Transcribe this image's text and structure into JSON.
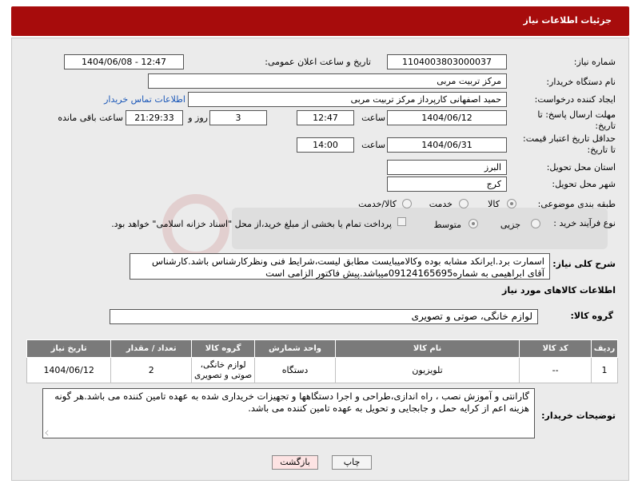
{
  "header": {
    "title": "جزئیات اطلاعات نیاز"
  },
  "form": {
    "need_number_label": "شماره نیاز:",
    "need_number": "1104003803000037",
    "announce_label": "تاریخ و ساعت اعلان عمومی:",
    "announce_value": "1404/06/08 - 12:47",
    "buyer_org_label": "نام دستگاه خریدار:",
    "buyer_org": "مرکز تربیت مربی",
    "requester_label": "ایجاد کننده درخواست:",
    "requester": "حمید اصفهانی کارپرداز مرکز تربیت مربی",
    "contact_link": "اطلاعات تماس خریدار",
    "deadline_label_1": "مهلت ارسال پاسخ: تا",
    "deadline_label_2": "تاریخ:",
    "deadline_date": "1404/06/12",
    "time_label": "ساعت",
    "deadline_time": "12:47",
    "days_value": "3",
    "days_label": "روز و",
    "remaining_value": "21:29:33",
    "remaining_label": "ساعت باقی مانده",
    "validity_label_1": "حداقل تاریخ اعتبار قیمت:",
    "validity_label_2": "تا تاریخ:",
    "validity_date": "1404/06/31",
    "validity_time_label": "ساعت",
    "validity_time": "14:00",
    "province_label": "استان محل تحویل:",
    "province": "البرز",
    "city_label": "شهر محل تحویل:",
    "city": "کرج",
    "category_label": "طبقه بندی موضوعی:",
    "category_options": [
      "کالا",
      "خدمت",
      "کالا/خدمت"
    ],
    "category_selected": "کالا",
    "process_label": "نوع فرآیند خرید :",
    "process_options": [
      "جزیی",
      "متوسط"
    ],
    "process_selected": "متوسط",
    "payment_note": "پرداخت تمام یا بخشی از مبلغ خرید،از محل \"اسناد خزانه اسلامی\" خواهد بود."
  },
  "description": {
    "label": "شرح کلی نیاز:",
    "text": "اسمارت برد.ایرانکد مشابه بوده وکالامیبایست مطابق لیست،شرایط فنی ونظرکارشناس باشد.کارشناس آقای ابراهیمی به شماره09124165695میباشد.پیش فاکتور الزامی است"
  },
  "goods": {
    "section_title": "اطلاعات کالاهای مورد نیاز",
    "group_label": "گروه کالا:",
    "group_value": "لوازم خانگی، صوتی و تصویری"
  },
  "table": {
    "headers": [
      "ردیف",
      "کد کالا",
      "نام کالا",
      "واحد شمارش",
      "گروه کالا",
      "تعداد / مقدار",
      "تاریخ نیاز"
    ],
    "rows": [
      {
        "row": "1",
        "code": "--",
        "name": "تلویزیون",
        "unit": "دستگاه",
        "group": "لوازم خانگی، صوتی و تصویری",
        "qty": "2",
        "date": "1404/06/12"
      }
    ]
  },
  "buyer_notes": {
    "label": "توضیحات خریدار:",
    "text": "گارانتی و آموزش نصب ، راه اندازی،طراحی و اجرا دستگاهها و تجهیزات خریداری شده به عهده تامین کننده می باشد.هر گونه هزینه اعم از کرایه حمل و جابجایی و تحویل به عهده تامین کننده می باشد."
  },
  "buttons": {
    "print": "چاپ",
    "back": "بازگشت"
  },
  "colors": {
    "header": "#a70c0c",
    "panel": "#ebebeb",
    "table_header": "#7a7a7a",
    "link": "#1a57b8"
  }
}
